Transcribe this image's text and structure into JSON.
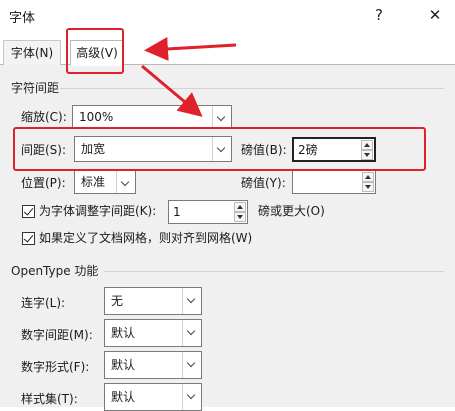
{
  "dialog": {
    "title": "字体",
    "help_glyph": "?",
    "close_glyph": "✕"
  },
  "tabs": [
    {
      "label": "字体(N)"
    },
    {
      "label": "高级(V)"
    }
  ],
  "char_spacing": {
    "section": "字符间距",
    "scale_label": "缩放(C):",
    "scale_value": "100%",
    "spacing_label": "间距(S):",
    "spacing_value": "加宽",
    "spacing_by_label": "磅值(B):",
    "spacing_by_value": "2磅",
    "position_label": "位置(P):",
    "position_value": "标准",
    "position_by_label": "磅值(Y):",
    "position_by_value": "",
    "kerning_label": "为字体调整字间距(K):",
    "kerning_value": "1",
    "kerning_suffix": "磅或更大(O)",
    "grid_label": "如果定义了文档网格，则对齐到网格(W)"
  },
  "opentype": {
    "section": "OpenType 功能",
    "ligatures_label": "连字(L):",
    "ligatures_value": "无",
    "num_spacing_label": "数字间距(M):",
    "num_spacing_value": "默认",
    "num_forms_label": "数字形式(F):",
    "num_forms_value": "默认",
    "stylistic_label": "样式集(T):",
    "stylistic_value": "默认"
  },
  "colors": {
    "annotation": "#e0202a",
    "panel": "#f0f0f0"
  }
}
